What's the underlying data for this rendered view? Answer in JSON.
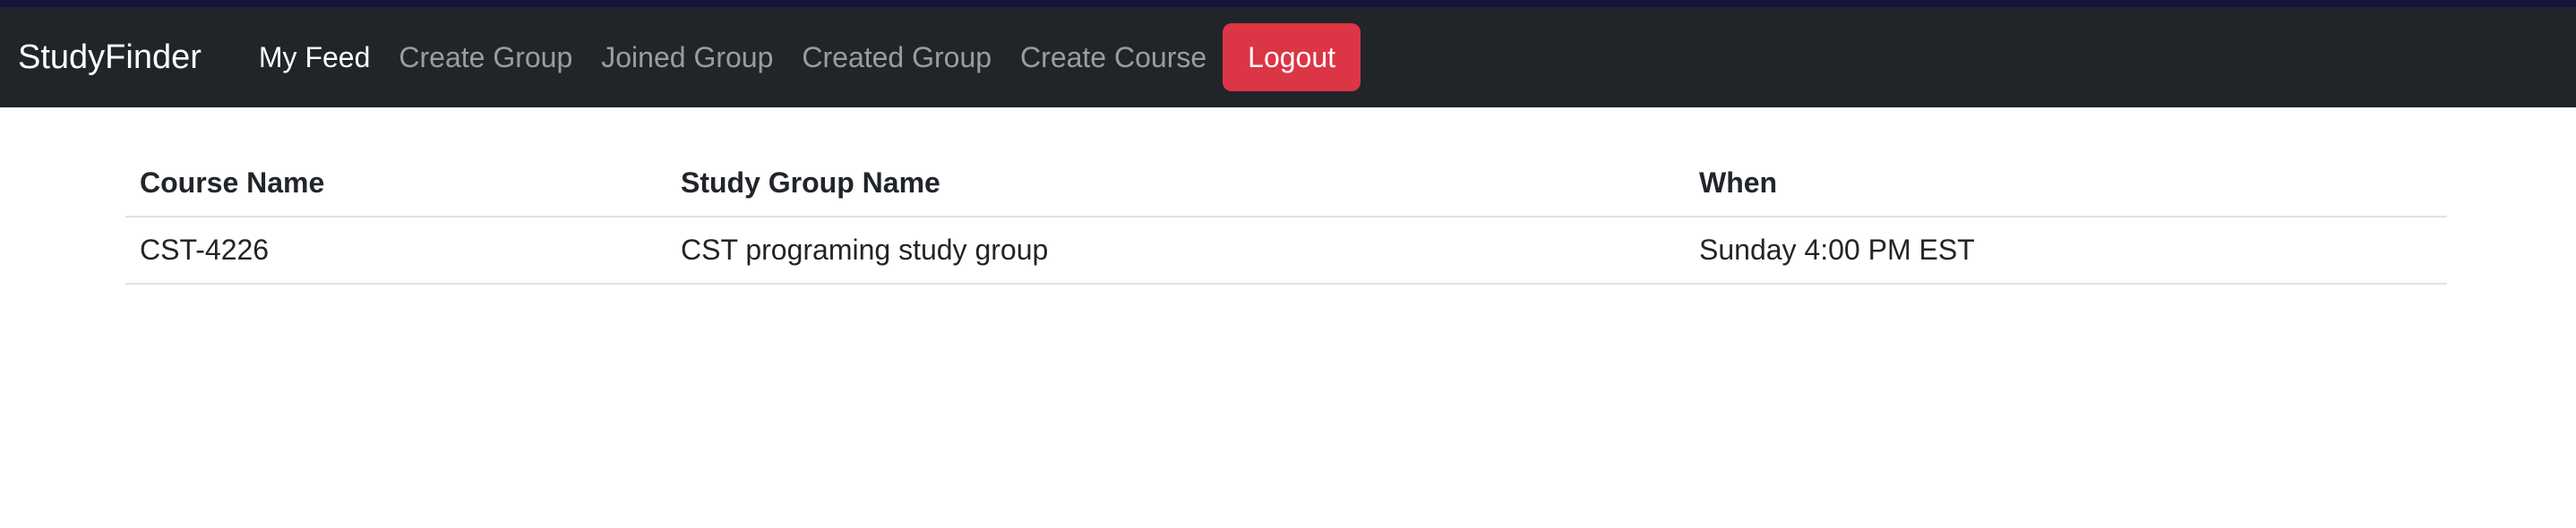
{
  "navbar": {
    "brand": "StudyFinder",
    "links": [
      {
        "label": "My Feed",
        "active": true
      },
      {
        "label": "Create Group",
        "active": false
      },
      {
        "label": "Joined Group",
        "active": false
      },
      {
        "label": "Created Group",
        "active": false
      },
      {
        "label": "Create Course",
        "active": false
      }
    ],
    "logout_label": "Logout"
  },
  "feed_table": {
    "headers": [
      "Course Name",
      "Study Group Name",
      "When"
    ],
    "rows": [
      [
        "CST-4226",
        "CST programing study group",
        "Sunday 4:00 PM EST"
      ]
    ]
  },
  "colors": {
    "navbar_bg": "#212529",
    "logout_bg": "#dc3545",
    "top_strip": "#14143a"
  }
}
